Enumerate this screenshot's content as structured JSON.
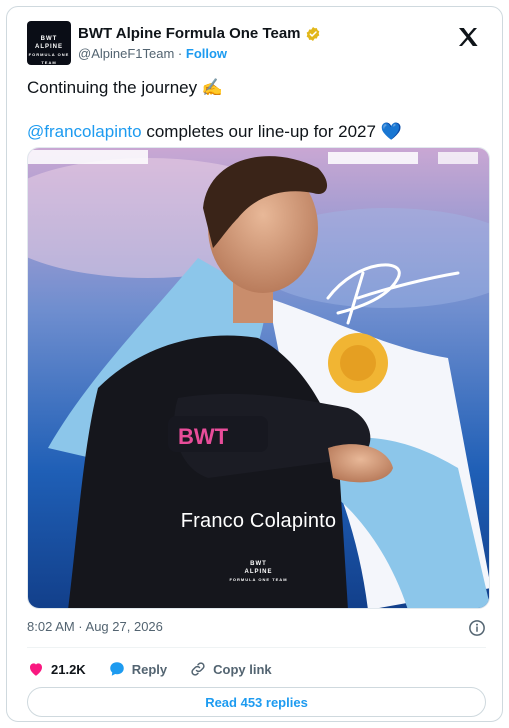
{
  "author": {
    "name": "BWT Alpine Formula One Team",
    "handle": "@AlpineF1Team",
    "separator": "·",
    "follow_label": "Follow",
    "avatar_logo_lines": [
      "BWT",
      "ALPINE",
      "FORMULA ONE TEAM"
    ]
  },
  "tweet": {
    "line1": "Continuing the journey",
    "line1_emoji": "✍️",
    "mention": "@francolapinto",
    "line2": " completes our line-up for 2027",
    "line2_emoji": "💙"
  },
  "media": {
    "caption": "Franco Colapinto",
    "sponsor_text": "BWT",
    "logo_lines": [
      "BWT",
      "ALPINE",
      "FORMULA ONE TEAM"
    ]
  },
  "meta": {
    "timestamp": "8:02 AM · Aug 27, 2026"
  },
  "actions": {
    "likes": "21.2K",
    "reply_label": "Reply",
    "copy_link_label": "Copy link"
  },
  "read_replies_label": "Read 453 replies",
  "colors": {
    "accent": "#1d9bf0",
    "like": "#f91880",
    "verified_gold": "#e2b719"
  }
}
